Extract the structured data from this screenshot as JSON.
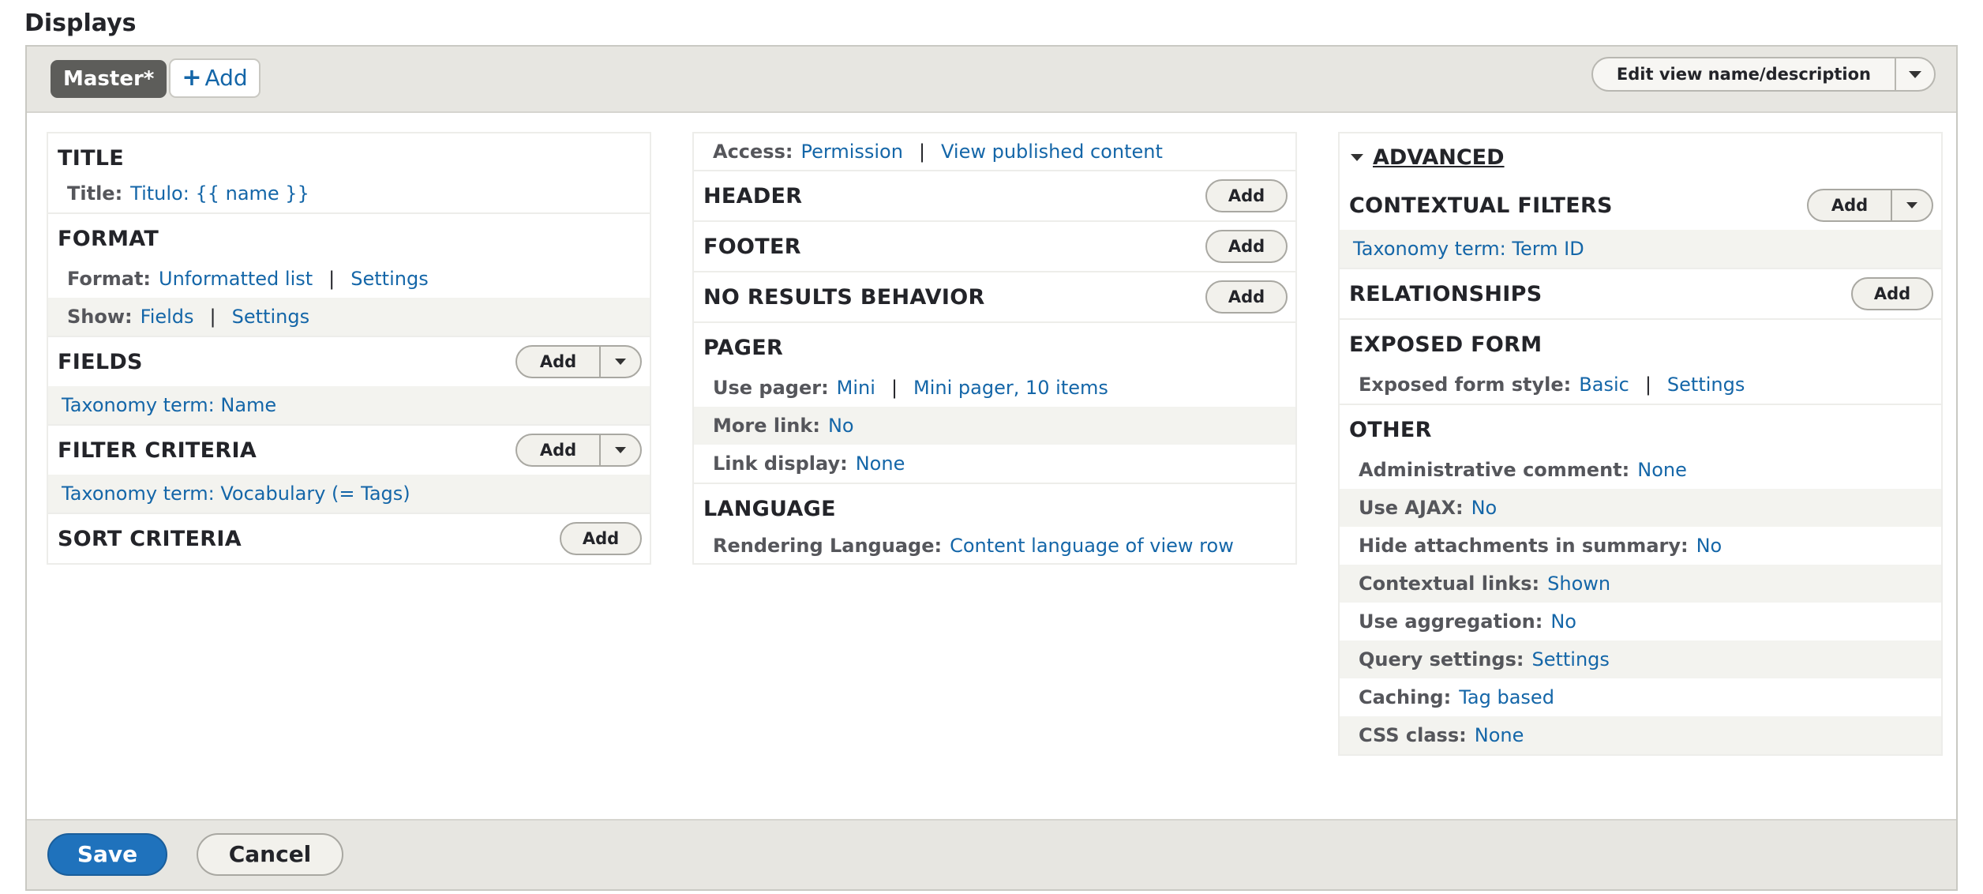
{
  "page_title": "Displays",
  "tabs": {
    "master_label": "Master*",
    "add_plus": "+",
    "add_label": "Add"
  },
  "edit_view_label": "Edit view name/description",
  "add_label": "Add",
  "col1": {
    "title": {
      "heading": "TITLE",
      "label": "Title:",
      "value": "Titulo: {{ name }}"
    },
    "format": {
      "heading": "FORMAT",
      "format_label": "Format:",
      "format_value": "Unformatted list",
      "format_settings": "Settings",
      "show_label": "Show:",
      "show_value": "Fields",
      "show_settings": "Settings"
    },
    "fields": {
      "heading": "FIELDS",
      "item": "Taxonomy term: Name"
    },
    "filter": {
      "heading": "FILTER CRITERIA",
      "item": "Taxonomy term: Vocabulary (= Tags)"
    },
    "sort": {
      "heading": "SORT CRITERIA"
    }
  },
  "col2": {
    "access": {
      "label": "Access:",
      "value": "Permission",
      "detail": "View published content"
    },
    "header": {
      "heading": "HEADER"
    },
    "footer": {
      "heading": "FOOTER"
    },
    "no_results": {
      "heading": "NO RESULTS BEHAVIOR"
    },
    "pager": {
      "heading": "PAGER",
      "use_pager_label": "Use pager:",
      "use_pager_value": "Mini",
      "use_pager_detail": "Mini pager, 10 items",
      "more_link_label": "More link:",
      "more_link_value": "No",
      "link_display_label": "Link display:",
      "link_display_value": "None"
    },
    "language": {
      "heading": "LANGUAGE",
      "label": "Rendering Language:",
      "value": "Content language of view row"
    }
  },
  "col3": {
    "advanced_heading": "ADVANCED",
    "contextual": {
      "heading": "CONTEXTUAL FILTERS",
      "item": "Taxonomy term: Term ID"
    },
    "relationships": {
      "heading": "RELATIONSHIPS"
    },
    "exposed": {
      "heading": "EXPOSED FORM",
      "label": "Exposed form style:",
      "value": "Basic",
      "settings": "Settings"
    },
    "other": {
      "heading": "OTHER",
      "rows": [
        {
          "label": "Administrative comment:",
          "value": "None"
        },
        {
          "label": "Use AJAX:",
          "value": "No"
        },
        {
          "label": "Hide attachments in summary:",
          "value": "No"
        },
        {
          "label": "Contextual links:",
          "value": "Shown"
        },
        {
          "label": "Use aggregation:",
          "value": "No"
        },
        {
          "label": "Query settings:",
          "value": "Settings"
        },
        {
          "label": "Caching:",
          "value": "Tag based"
        },
        {
          "label": "CSS class:",
          "value": "None"
        }
      ]
    }
  },
  "actions": {
    "save": "Save",
    "cancel": "Cancel"
  },
  "separator": "|",
  "colors": {
    "link": "#1466a8",
    "primary_button": "#1f72bc",
    "bar_bg": "#e7e6e1",
    "tab_active": "#5d5d5a"
  }
}
